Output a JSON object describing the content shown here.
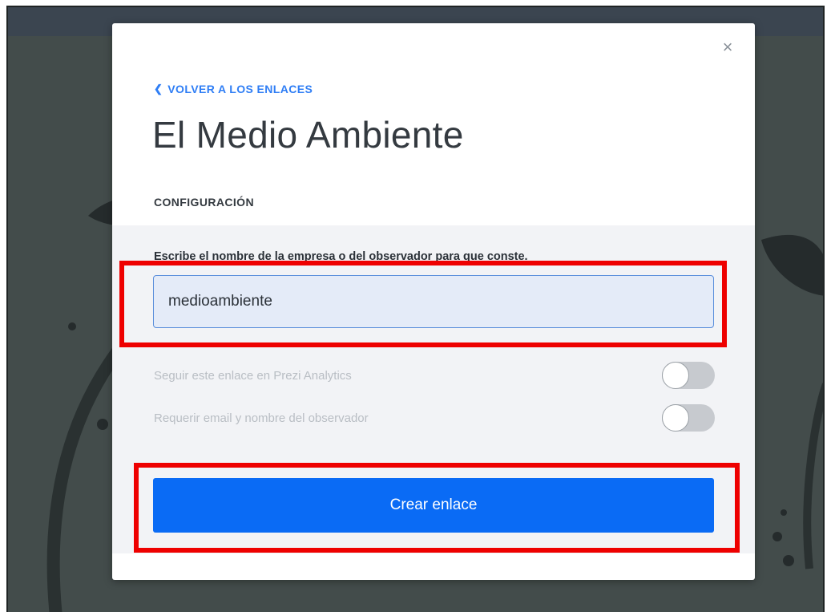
{
  "modal": {
    "close_symbol": "×",
    "back_link": {
      "icon": "chevron-left-icon",
      "chevron": "❮",
      "label": "VOLVER A LOS ENLACES"
    },
    "title": "El Medio Ambiente",
    "section_label": "CONFIGURACIÓN",
    "settings": {
      "field_label": "Escribe el nombre de la empresa o del observador para que conste.",
      "input_value": "medioambiente",
      "toggles": [
        {
          "label": "Seguir este enlace en Prezi Analytics",
          "on": false
        },
        {
          "label": "Requerir email y nombre del observador",
          "on": false
        }
      ],
      "submit_label": "Crear enlace"
    }
  },
  "colors": {
    "accent": "#0a6bf5",
    "link": "#2f7ef5",
    "highlight": "#ee0000",
    "backdrop": "#434c4b",
    "panel": "#f2f3f6",
    "input_bg": "#e4ebf8"
  }
}
